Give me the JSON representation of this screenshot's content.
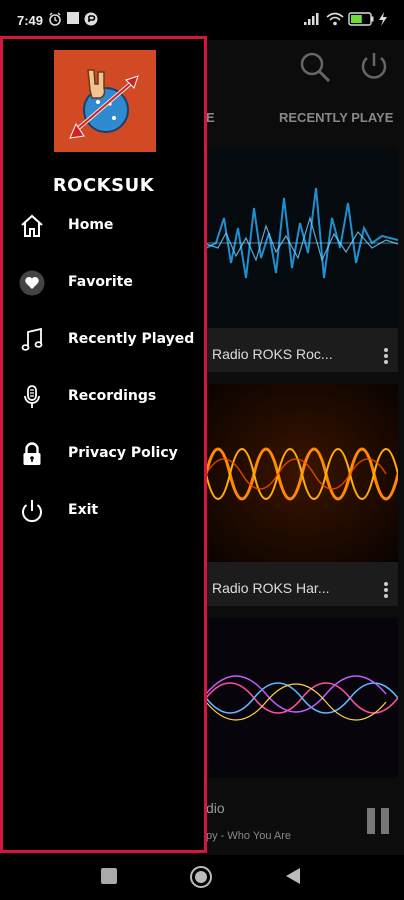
{
  "status_bar": {
    "time": "7:49",
    "battery_level": 0.6
  },
  "app": {
    "tabs": [
      "E",
      "RECENTLY PLAYE"
    ],
    "cards": [
      {
        "title": "Radio ROKS Roc...",
        "accent": "#2a9fd6"
      },
      {
        "title": "Radio ROKS Har...",
        "accent": "#ff7a00"
      },
      {
        "title": "",
        "accent": "#c060ff"
      }
    ],
    "player": {
      "title": "dio",
      "subtitle": "py - Who You Are"
    }
  },
  "drawer": {
    "brand": "ROCKSUK",
    "items": [
      {
        "label": "Home",
        "icon": "home-icon"
      },
      {
        "label": "Favorite",
        "icon": "heart-icon"
      },
      {
        "label": "Recently Played",
        "icon": "music-note-icon"
      },
      {
        "label": "Recordings",
        "icon": "microphone-icon"
      },
      {
        "label": "Privacy Policy",
        "icon": "lock-icon"
      },
      {
        "label": "Exit",
        "icon": "power-icon"
      }
    ]
  },
  "colors": {
    "drawer_border": "#d3163e",
    "logo_background": "#d24a23"
  }
}
